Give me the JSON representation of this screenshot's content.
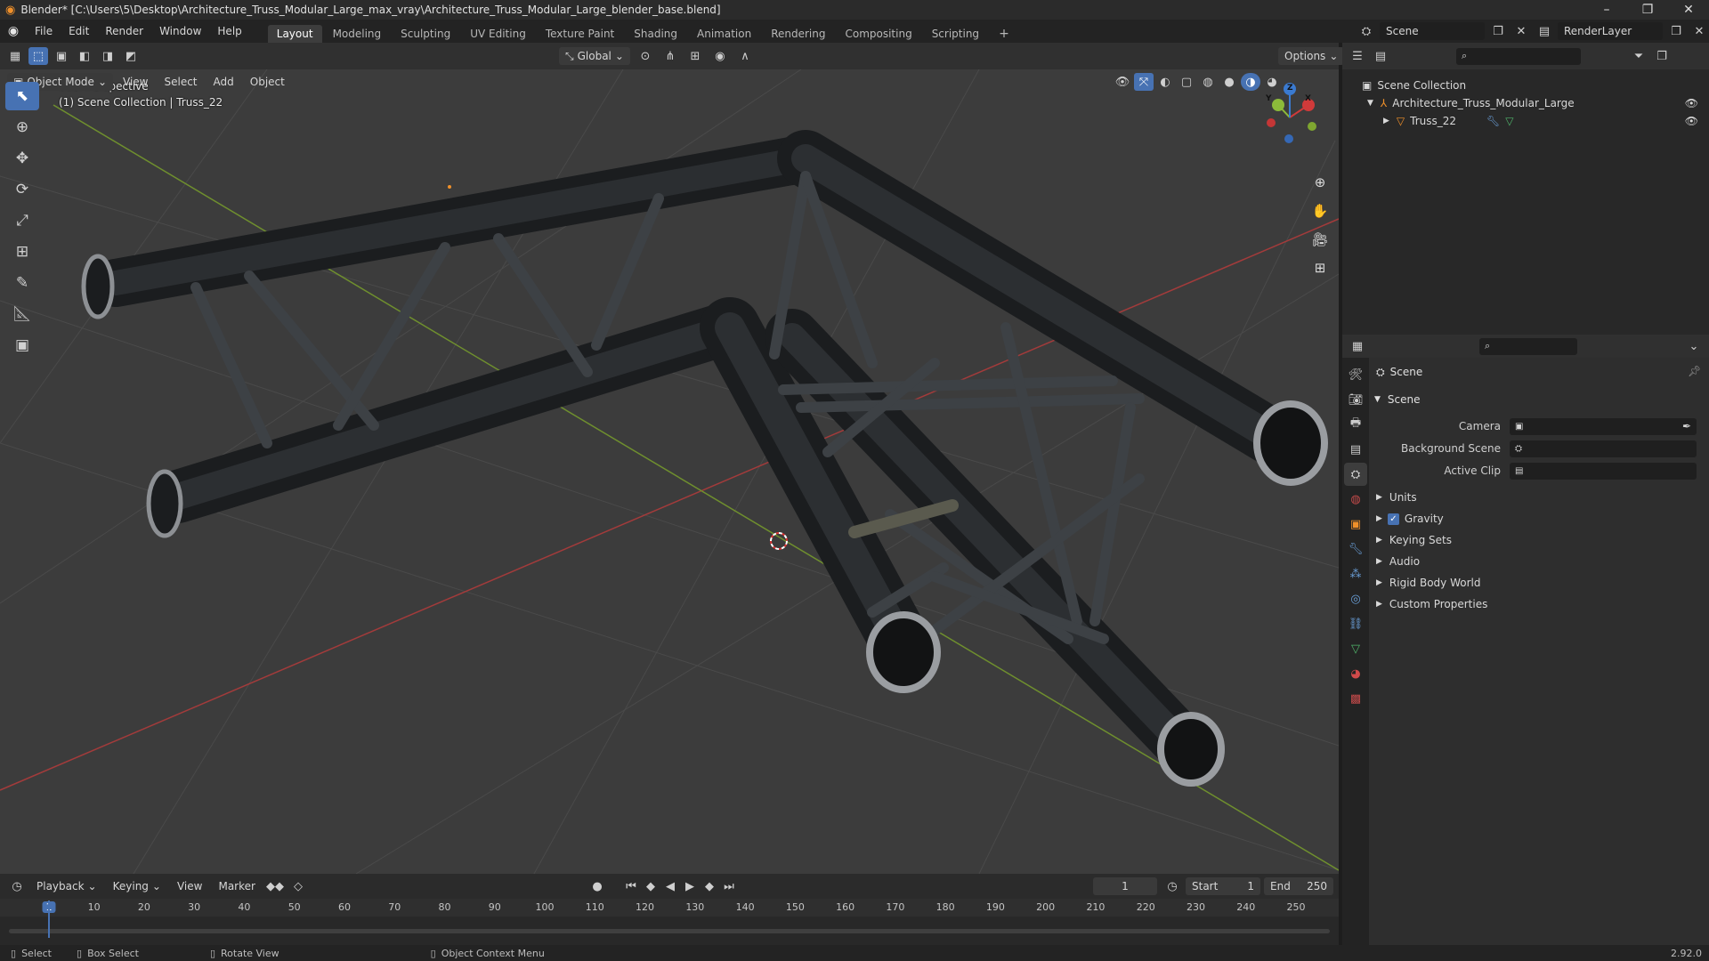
{
  "window": {
    "title": "Blender* [C:\\Users\\5\\Desktop\\Architecture_Truss_Modular_Large_max_vray\\Architecture_Truss_Modular_Large_blender_base.blend]"
  },
  "menu": [
    "File",
    "Edit",
    "Render",
    "Window",
    "Help"
  ],
  "workspaces": [
    "Layout",
    "Modeling",
    "Sculpting",
    "UV Editing",
    "Texture Paint",
    "Shading",
    "Animation",
    "Rendering",
    "Compositing",
    "Scripting"
  ],
  "scene_selector": {
    "scene": "Scene",
    "view_layer": "RenderLayer"
  },
  "tool_header": {
    "orientation": "Global",
    "options": "Options"
  },
  "viewport_header": {
    "mode": "Object Mode",
    "menus": [
      "View",
      "Select",
      "Add",
      "Object"
    ]
  },
  "viewport": {
    "perspective": "User Perspective",
    "collection_info": "(1) Scene Collection | Truss_22",
    "gizmo": {
      "x": "X",
      "y": "Y",
      "z": "Z"
    }
  },
  "outliner": {
    "root": "Scene Collection",
    "items": [
      {
        "label": "Architecture_Truss_Modular_Large"
      },
      {
        "label": "Truss_22"
      }
    ]
  },
  "properties": {
    "header": "Scene",
    "section": "Scene",
    "fields": [
      {
        "label": "Camera",
        "value": ""
      },
      {
        "label": "Background Scene",
        "value": ""
      },
      {
        "label": "Active Clip",
        "value": ""
      }
    ],
    "panels": [
      "Units",
      "Gravity",
      "Keying Sets",
      "Audio",
      "Rigid Body World",
      "Custom Properties"
    ],
    "gravity_checked": true
  },
  "timeline": {
    "menus": [
      "Playback",
      "Keying",
      "View",
      "Marker"
    ],
    "current_frame": "1",
    "start_label": "Start",
    "start": "1",
    "end_label": "End",
    "end": "250",
    "ruler": [
      "1",
      "10",
      "20",
      "30",
      "40",
      "50",
      "60",
      "70",
      "80",
      "90",
      "100",
      "110",
      "120",
      "130",
      "140",
      "150",
      "160",
      "170",
      "180",
      "190",
      "200",
      "210",
      "220",
      "230",
      "240",
      "250"
    ]
  },
  "statusbar": {
    "items": [
      "Select",
      "Box Select",
      "Rotate View",
      "Object Context Menu"
    ],
    "version": "2.92.0"
  },
  "colors": {
    "accent": "#4772b3",
    "x_axis": "#d03a3a",
    "y_axis": "#8cba3a",
    "z_axis": "#3a7ad0"
  }
}
